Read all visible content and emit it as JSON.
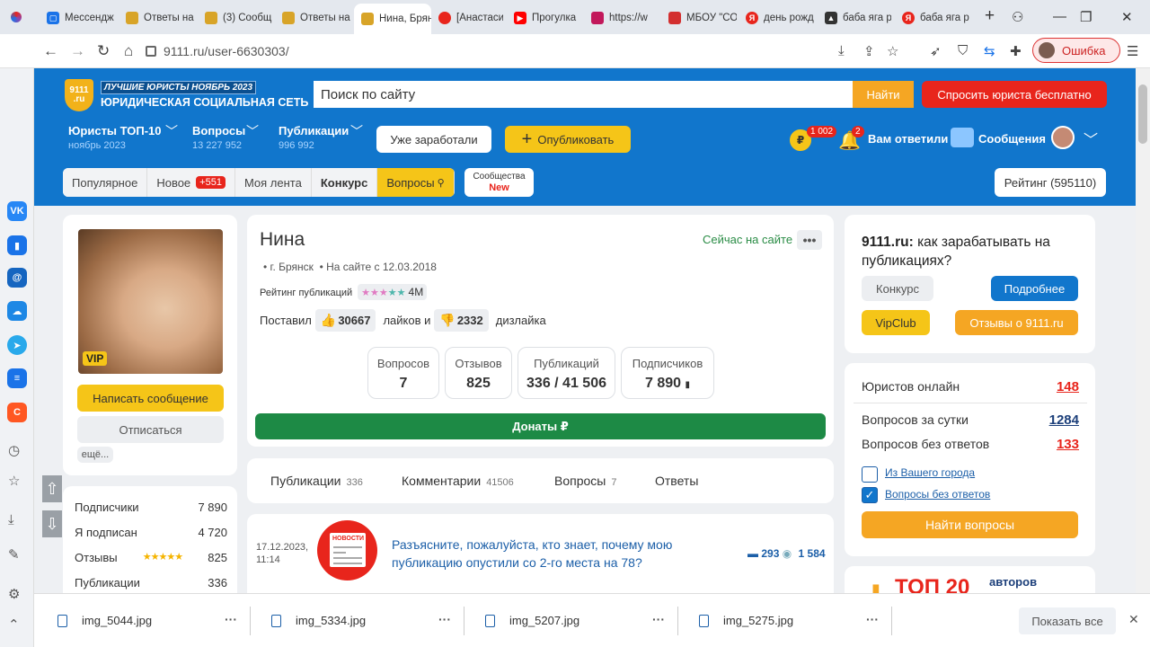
{
  "browser": {
    "tabs": [
      {
        "label": "Мессендж",
        "color": "#1a73e8"
      },
      {
        "label": "Ответы на",
        "color": "#d8a428"
      },
      {
        "label": "(3) Сообщ",
        "color": "#d8a428"
      },
      {
        "label": "Ответы на",
        "color": "#d8a428"
      },
      {
        "label": "Нина, Брян",
        "color": "#d8a428"
      },
      {
        "label": "[Анастаси",
        "color": "#e8251c"
      },
      {
        "label": "Прогулка",
        "color": "#ff0000"
      },
      {
        "label": "https://w",
        "color": "#c2185b"
      },
      {
        "label": "МБОУ \"СО",
        "color": "#d32f2f"
      },
      {
        "label": "день рожд",
        "color": "#e8251c"
      },
      {
        "label": "баба яга р",
        "color": "#333333"
      },
      {
        "label": "баба яга р",
        "color": "#e8251c"
      }
    ],
    "new_tab": "+",
    "url": "9111.ru/user-6630303/",
    "error_button": "Ошибка"
  },
  "header": {
    "logo_badge": "9111 .ru",
    "logo_best": "ЛУЧШИЕ ЮРИСТЫ НОЯБРЬ 2023",
    "logo_name": "ЮРИДИЧЕСКАЯ СОЦИАЛЬНАЯ СЕТЬ",
    "search_placeholder": "Поиск по сайту",
    "search_button": "Найти",
    "ask_button": "Спросить юриста бесплатно",
    "nav": [
      {
        "label": "Юристы ТОП-10",
        "sub": "ноябрь 2023"
      },
      {
        "label": "Вопросы",
        "sub": "13 227 952"
      },
      {
        "label": "Публикации",
        "sub": "996 992"
      }
    ],
    "earned_button": "Уже заработали",
    "publish_button": "Опубликовать",
    "coin_label": "₽",
    "coin_badge": "1 002",
    "bell_badge": "2",
    "replied": "Вам ответили",
    "messages": "Сообщения"
  },
  "subnav": {
    "items": [
      "Популярное",
      "Новое",
      "Моя лента",
      "Конкурс",
      "Вопросы"
    ],
    "new_count": "+551",
    "communities": "Сообщества",
    "communities_badge": "New",
    "rating": "Рейтинг (595110)"
  },
  "profile": {
    "vip": "VIP",
    "write_button": "Написать сообщение",
    "unsub_button": "Отписаться",
    "more_button": "ещё...",
    "stats": [
      {
        "label": "Подписчики",
        "value": "7 890"
      },
      {
        "label": "Я подписан",
        "value": "4 720"
      },
      {
        "label": "Отзывы",
        "value": "825"
      },
      {
        "label": "Публикации",
        "value": "336"
      }
    ],
    "name": "Нина",
    "online": "Сейчас на сайте",
    "city": "г. Брянск",
    "since": "На сайте с 12.03.2018",
    "pub_rating_label": "Рейтинг публикаций",
    "pub_rating_value": "4M",
    "likes_prefix": "Поставил",
    "likes": "30667",
    "likes_mid": "лайков и",
    "dislikes": "2332",
    "dislikes_suffix": "дизлайка",
    "boxes": [
      {
        "label": "Вопросов",
        "value": "7"
      },
      {
        "label": "Отзывов",
        "value": "825"
      },
      {
        "label": "Публикаций",
        "value": "336 / 41 506"
      },
      {
        "label": "Подписчиков",
        "value": "7 890"
      }
    ],
    "donate": "Донаты ₽"
  },
  "tabs": [
    {
      "label": "Публикации",
      "count": "336"
    },
    {
      "label": "Комментарии",
      "count": "41506"
    },
    {
      "label": "Вопросы",
      "count": "7"
    },
    {
      "label": "Ответы",
      "count": ""
    }
  ],
  "publication": {
    "date": "17.12.2023,",
    "time": "11:14",
    "icon_label": "НОВОСТИ",
    "title": "Разъясните, пожалуйста, кто знает, почему мою публикацию опустили со 2-го места на 78?",
    "comments": "293",
    "views": "1 584"
  },
  "right": {
    "promo_site": "9111.ru:",
    "promo_text": "как зарабатывать на публикациях?",
    "btn_contest": "Конкурс",
    "btn_more": "Подробнее",
    "btn_vip": "VipClub",
    "btn_reviews": "Отзывы о 9111.ru",
    "rows": [
      {
        "label": "Юристов онлайн",
        "value": "148"
      },
      {
        "label": "Вопросов за сутки",
        "value": "1284"
      },
      {
        "label": "Вопросов без ответов",
        "value": "133"
      }
    ],
    "check_city": "Из Вашего города",
    "check_unanswered": "Вопросы без ответов",
    "find_button": "Найти вопросы",
    "top20": "ТОП 20",
    "top20_sub": "авторов"
  },
  "downloads": {
    "files": [
      "img_5044.jpg",
      "img_5334.jpg",
      "img_5207.jpg",
      "img_5275.jpg"
    ],
    "show_all": "Показать все"
  }
}
